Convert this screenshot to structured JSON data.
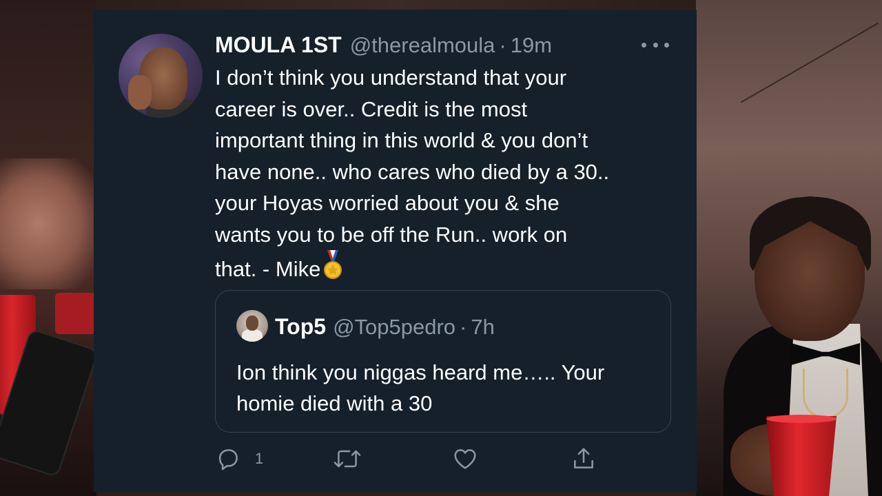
{
  "tweet": {
    "display_name": "MOULA 1ST",
    "handle": "@therealmoula",
    "separator": "·",
    "time": "19m",
    "text": "I don’t think you understand that your\ncareer is over.. Credit is the most\nimportant thing in this world & you don’t\nhave none.. who cares who died by a 30..\nyour Hoyas worried about you & she\nwants you to be off the Run.. work on\nthat. - Mike",
    "text_emoji": "medal-icon"
  },
  "quoted_tweet": {
    "display_name": "Top5",
    "handle": "@Top5pedro",
    "separator": "·",
    "time": "7h",
    "text": "Ion think you niggas heard me….. Your homie died with a 30"
  },
  "actions": {
    "reply_count": "1",
    "icons": [
      "reply-icon",
      "retweet-icon",
      "like-icon",
      "share-icon"
    ]
  },
  "colors": {
    "card_background": "#15202b",
    "secondary_text": "#8b98a5",
    "border": "#38444d",
    "primary_text": "#ffffff"
  }
}
